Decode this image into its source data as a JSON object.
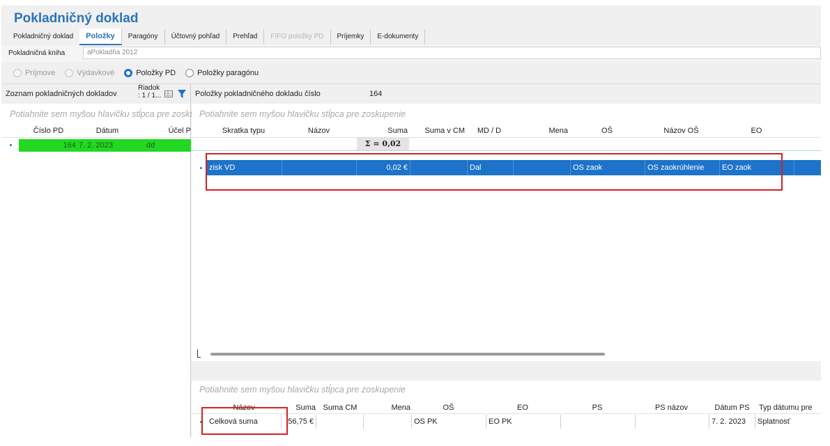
{
  "header": {
    "title": "Pokladničný doklad"
  },
  "tabs": [
    {
      "label": "Pokladničný doklad",
      "state": "normal"
    },
    {
      "label": "Položky",
      "state": "active"
    },
    {
      "label": "Paragóny",
      "state": "normal"
    },
    {
      "label": "Účtovný pohľad",
      "state": "normal"
    },
    {
      "label": "Prehľad",
      "state": "normal"
    },
    {
      "label": "FIFO položky PD",
      "state": "disabled"
    },
    {
      "label": "Príjemky",
      "state": "normal"
    },
    {
      "label": "E-dokumenty",
      "state": "normal"
    }
  ],
  "kniha": {
    "label": "Pokladničná kniha",
    "value": "aPokladňa 2012"
  },
  "radios": [
    {
      "label": "Príjmove",
      "state": "disabled"
    },
    {
      "label": "Výdavkové",
      "state": "disabled"
    },
    {
      "label": "Položky PD",
      "state": "selected"
    },
    {
      "label": "Položky paragónu",
      "state": "normal"
    }
  ],
  "left": {
    "title": "Zoznam pokladničných dokladov",
    "riadok_label": "Riadok",
    "riadok_value": ": 1 / 1...",
    "group_hint": "Potiahnite sem myšou hlavičku stĺpca pre zoskupenie",
    "columns": [
      "Číslo PD",
      "Dátum",
      "Účel P"
    ],
    "row": {
      "cislo": "164",
      "datum": "7. 2. 2023",
      "ucel": "dd"
    }
  },
  "right": {
    "title_label": "Položky pokladničného dokladu číslo",
    "title_value": "164",
    "group_hint": "Potiahnite sem myšou hlavičku stĺpca pre zoskupenie",
    "columns": [
      "Skratka typu",
      "Názov",
      "Suma",
      "Suma v CM",
      "MD / D",
      "Mena",
      "OŠ",
      "Názov OŠ",
      "EO"
    ],
    "sum": "Σ = 0,02",
    "row": {
      "skratka": "zisk VD",
      "suma": "0,02 €",
      "mdd": "Dal",
      "os": "OS zaok",
      "nazov_os": "OS zaokrúhlenie",
      "eo": "EO zaok"
    }
  },
  "bottom": {
    "group_hint": "Potiahnite sem myšou hlavičku stĺpca pre zoskupenie",
    "columns": [
      "Názov",
      "Suma",
      "Suma CM",
      "Mena",
      "OŠ",
      "EO",
      "PS",
      "PS názov",
      "Dátum PS",
      "Typ dátumu pre"
    ],
    "row": {
      "nazov": "Celková suma",
      "suma": "56,75 €",
      "os": "OS PK",
      "eo": "EO PK",
      "datum_ps": "7. 2. 2023",
      "typ": "Splatnosť"
    }
  },
  "colors": {
    "accent": "#2b73b8",
    "selection": "#1c73c9",
    "highlight_row": "#22d822",
    "annotation": "#d62020"
  }
}
